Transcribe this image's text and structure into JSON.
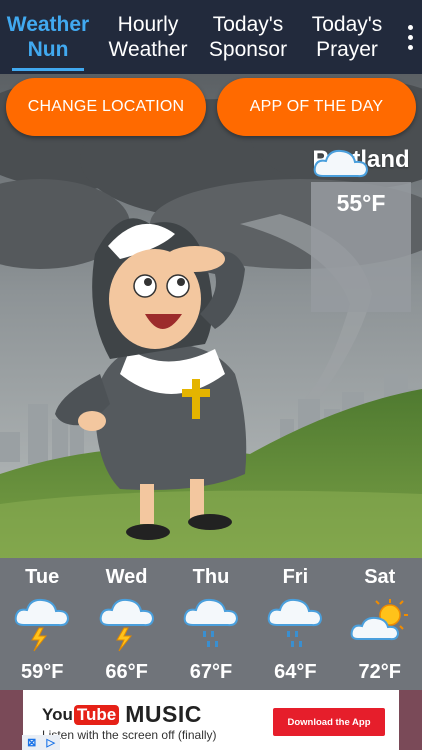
{
  "nav": {
    "tabs": [
      {
        "line1": "Weather",
        "line2": "Nun",
        "active": true
      },
      {
        "line1": "Hourly",
        "line2": "Weather",
        "active": false
      },
      {
        "line1": "Today's",
        "line2": "Sponsor",
        "active": false
      },
      {
        "line1": "Today's",
        "line2": "Prayer",
        "active": false
      }
    ],
    "menu_icon": "more-vert-icon"
  },
  "actions": {
    "change_location": "CHANGE LOCATION",
    "app_of_the_day": "APP OF THE DAY"
  },
  "current": {
    "city": "Portland",
    "temperature": "55°F",
    "icon": "cloudy-icon"
  },
  "forecast": [
    {
      "day": "Tue",
      "temp": "59°F",
      "icon": "thunderstorm-icon"
    },
    {
      "day": "Wed",
      "temp": "66°F",
      "icon": "thunderstorm-icon"
    },
    {
      "day": "Thu",
      "temp": "67°F",
      "icon": "rain-icon"
    },
    {
      "day": "Fri",
      "temp": "64°F",
      "icon": "rain-icon"
    },
    {
      "day": "Sat",
      "temp": "72°F",
      "icon": "partly-sunny-icon"
    }
  ],
  "ad": {
    "brand_you": "You",
    "brand_tube": "Tube",
    "product": "MUSIC",
    "tagline": "Listen with the screen off (finally)",
    "cta": "Download the App",
    "adchoices_icon": "adchoices-icon"
  },
  "colors": {
    "nav_bg": "#222a3c",
    "active_tab": "#41a9f0",
    "action_button": "#ff6a00",
    "cta_red": "#e61e2b"
  }
}
